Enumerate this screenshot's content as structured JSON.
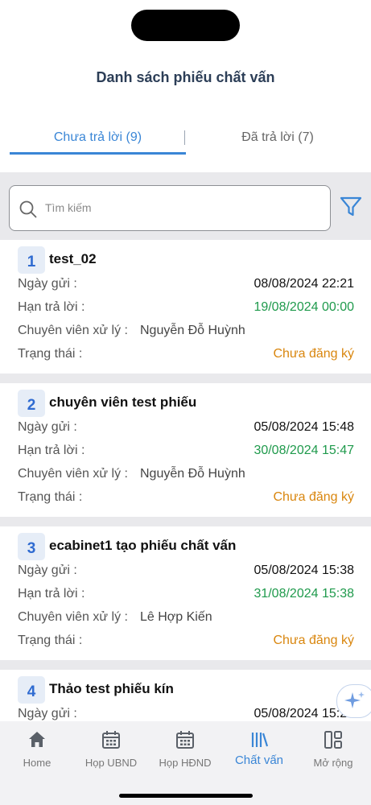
{
  "page": {
    "title": "Danh sách phiếu chất vấn"
  },
  "tabs": [
    {
      "label": "Chưa trả lời (9)",
      "active": true
    },
    {
      "label": "Đã trả lời (7)",
      "active": false
    }
  ],
  "search": {
    "placeholder": "Tìm kiếm"
  },
  "labels": {
    "sent_date": "Ngày gửi :",
    "deadline": "Hạn trả lời :",
    "specialist": "Chuyên viên xử lý :",
    "status": "Trạng thái :"
  },
  "items": [
    {
      "index": "1",
      "title": "test_02",
      "sent_date": "08/08/2024 22:21",
      "deadline": "19/08/2024 00:00",
      "specialist": "Nguyễn Đỗ Huỳnh",
      "status": "Chưa đăng ký"
    },
    {
      "index": "2",
      "title": "chuyên viên test phiếu",
      "sent_date": "05/08/2024 15:48",
      "deadline": "30/08/2024 15:47",
      "specialist": "Nguyễn Đỗ Huỳnh",
      "status": "Chưa đăng ký"
    },
    {
      "index": "3",
      "title": "ecabinet1 tạo phiếu chất vấn",
      "sent_date": "05/08/2024 15:38",
      "deadline": "31/08/2024 15:38",
      "specialist": "Lê Hợp Kiến",
      "status": "Chưa đăng ký"
    },
    {
      "index": "4",
      "title": "Thảo test phiếu kín",
      "sent_date": "05/08/2024 15:26"
    }
  ],
  "nav": [
    {
      "label": "Home",
      "icon": "home-icon"
    },
    {
      "label": "Họp UBND",
      "icon": "calendar-icon"
    },
    {
      "label": "Họp HĐND",
      "icon": "calendar-icon"
    },
    {
      "label": "Chất vấn",
      "icon": "library-icon",
      "active": true
    },
    {
      "label": "Mở rộng",
      "icon": "grid-layout-icon"
    }
  ],
  "colors": {
    "accent": "#3a86d6",
    "deadline": "#1f9a4c",
    "status": "#d9860e"
  }
}
